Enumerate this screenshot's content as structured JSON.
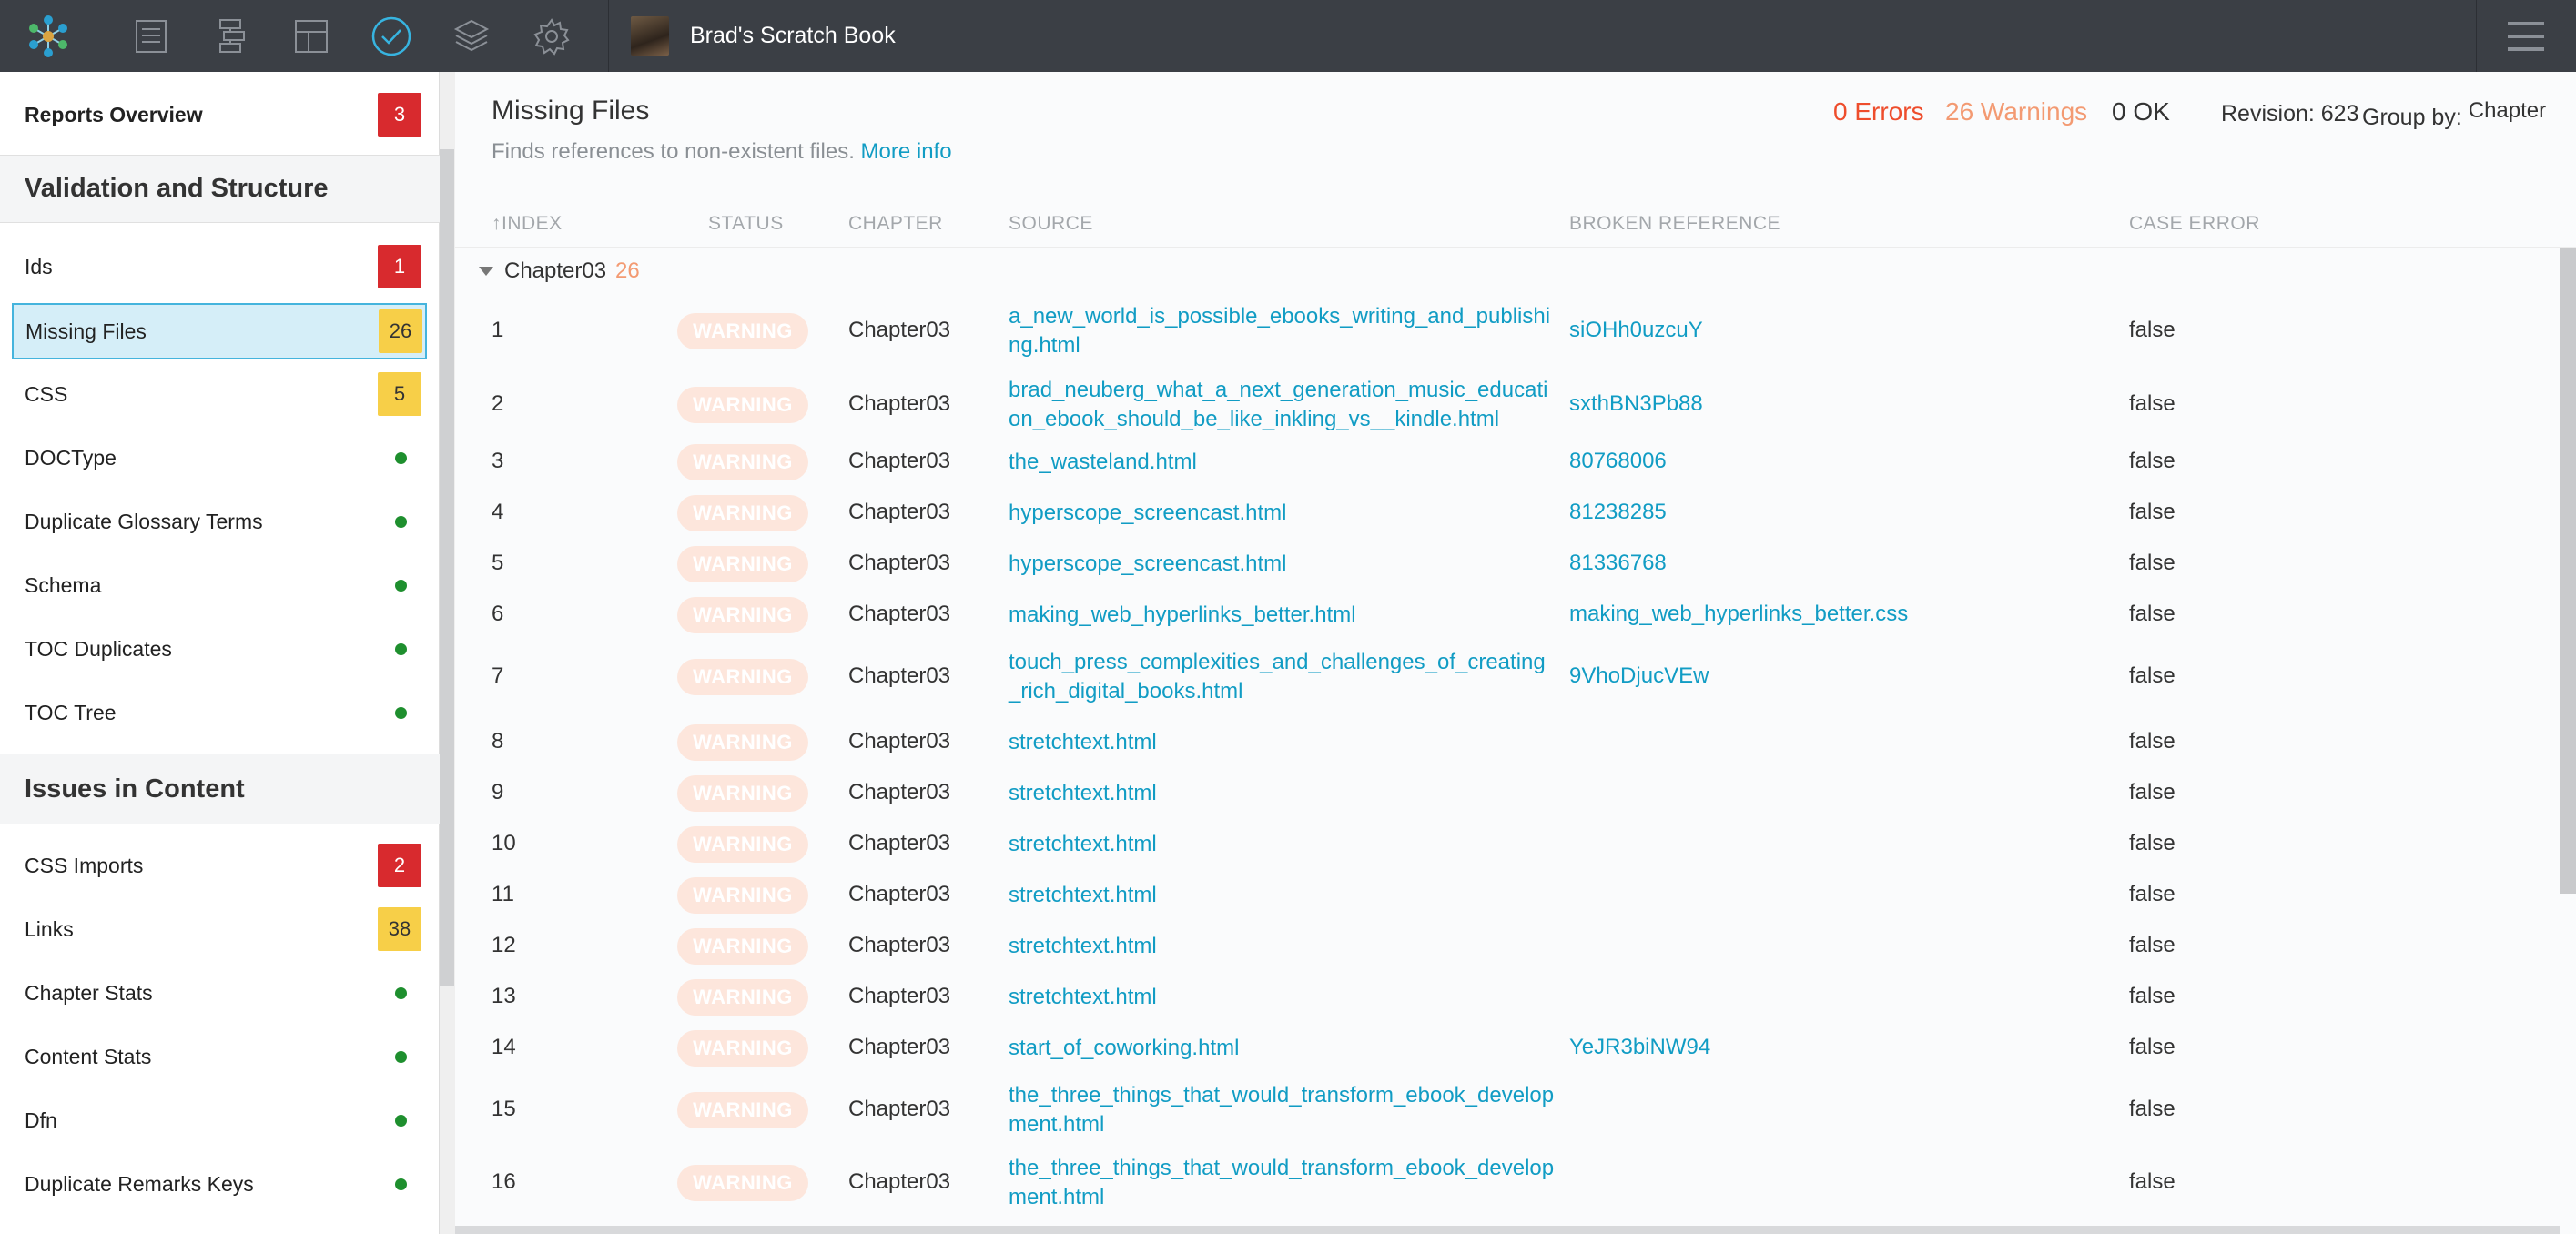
{
  "app": {
    "book_title": "Brad's Scratch Book",
    "toolbar_icons": [
      "list-icon",
      "structure-icon",
      "layout-icon",
      "check-circle-icon",
      "layers-icon",
      "gear-icon"
    ]
  },
  "sidebar": {
    "overview": {
      "label": "Reports Overview",
      "count": "3"
    },
    "sections": [
      {
        "title": "Validation and Structure",
        "items": [
          {
            "label": "Ids",
            "count": "1",
            "badge": "red"
          },
          {
            "label": "Missing Files",
            "count": "26",
            "badge": "yellow",
            "active": true
          },
          {
            "label": "CSS",
            "count": "5",
            "badge": "yellow"
          },
          {
            "label": "DOCType",
            "badge": "dot"
          },
          {
            "label": "Duplicate Glossary Terms",
            "badge": "dot"
          },
          {
            "label": "Schema",
            "badge": "dot"
          },
          {
            "label": "TOC Duplicates",
            "badge": "dot"
          },
          {
            "label": "TOC Tree",
            "badge": "dot"
          }
        ]
      },
      {
        "title": "Issues in Content",
        "items": [
          {
            "label": "CSS Imports",
            "count": "2",
            "badge": "red"
          },
          {
            "label": "Links",
            "count": "38",
            "badge": "yellow"
          },
          {
            "label": "Chapter Stats",
            "badge": "dot"
          },
          {
            "label": "Content Stats",
            "badge": "dot"
          },
          {
            "label": "Dfn",
            "badge": "dot"
          },
          {
            "label": "Duplicate Remarks Keys",
            "badge": "dot"
          }
        ]
      }
    ]
  },
  "report": {
    "title": "Missing Files",
    "description": "Finds references to non-existent files.",
    "more_info": "More info",
    "errors": "0 Errors",
    "warnings": "26 Warnings",
    "ok": "0 OK",
    "revision": "Revision: 623",
    "group_by_label": "Group by:",
    "group_by_value": "Chapter",
    "columns": [
      "INDEX",
      "STATUS",
      "CHAPTER",
      "SOURCE",
      "BROKEN REFERENCE",
      "CASE ERROR"
    ],
    "sort_indicator": "↑",
    "group": {
      "name": "Chapter03",
      "count": "26"
    },
    "rows": [
      {
        "index": "1",
        "status": "WARNING",
        "chapter": "Chapter03",
        "source": "a_new_world_is_possible_ebooks_writing_and_publishing.html",
        "reference": "siOHh0uzcuY",
        "case_error": "false"
      },
      {
        "index": "2",
        "status": "WARNING",
        "chapter": "Chapter03",
        "source": "brad_neuberg_what_a_next_generation_music_education_ebook_should_be_like_inkling_vs__kindle.html",
        "reference": "sxthBN3Pb88",
        "case_error": "false"
      },
      {
        "index": "3",
        "status": "WARNING",
        "chapter": "Chapter03",
        "source": "the_wasteland.html",
        "reference": "80768006",
        "case_error": "false"
      },
      {
        "index": "4",
        "status": "WARNING",
        "chapter": "Chapter03",
        "source": "hyperscope_screencast.html",
        "reference": "81238285",
        "case_error": "false"
      },
      {
        "index": "5",
        "status": "WARNING",
        "chapter": "Chapter03",
        "source": "hyperscope_screencast.html",
        "reference": "81336768",
        "case_error": "false"
      },
      {
        "index": "6",
        "status": "WARNING",
        "chapter": "Chapter03",
        "source": "making_web_hyperlinks_better.html",
        "reference": "making_web_hyperlinks_better.css",
        "case_error": "false"
      },
      {
        "index": "7",
        "status": "WARNING",
        "chapter": "Chapter03",
        "source": "touch_press_complexities_and_challenges_of_creating_rich_digital_books.html",
        "reference": "9VhoDjucVEw",
        "case_error": "false"
      },
      {
        "index": "8",
        "status": "WARNING",
        "chapter": "Chapter03",
        "source": "stretchtext.html",
        "reference": "",
        "case_error": "false"
      },
      {
        "index": "9",
        "status": "WARNING",
        "chapter": "Chapter03",
        "source": "stretchtext.html",
        "reference": "",
        "case_error": "false"
      },
      {
        "index": "10",
        "status": "WARNING",
        "chapter": "Chapter03",
        "source": "stretchtext.html",
        "reference": "",
        "case_error": "false"
      },
      {
        "index": "11",
        "status": "WARNING",
        "chapter": "Chapter03",
        "source": "stretchtext.html",
        "reference": "",
        "case_error": "false"
      },
      {
        "index": "12",
        "status": "WARNING",
        "chapter": "Chapter03",
        "source": "stretchtext.html",
        "reference": "",
        "case_error": "false"
      },
      {
        "index": "13",
        "status": "WARNING",
        "chapter": "Chapter03",
        "source": "stretchtext.html",
        "reference": "",
        "case_error": "false"
      },
      {
        "index": "14",
        "status": "WARNING",
        "chapter": "Chapter03",
        "source": "start_of_coworking.html",
        "reference": "YeJR3biNW94",
        "case_error": "false"
      },
      {
        "index": "15",
        "status": "WARNING",
        "chapter": "Chapter03",
        "source": "the_three_things_that_would_transform_ebook_development.html",
        "reference": "",
        "case_error": "false"
      },
      {
        "index": "16",
        "status": "WARNING",
        "chapter": "Chapter03",
        "source": "the_three_things_that_would_transform_ebook_development.html",
        "reference": "",
        "case_error": "false"
      }
    ]
  },
  "colors": {
    "topbar": "#3b3f45",
    "error": "#ee4d2c",
    "warning": "#f39a72",
    "link": "#119cc4",
    "badge_red": "#d82a2e",
    "badge_yellow": "#f7cf48",
    "ok_dot": "#1e8f2e"
  }
}
